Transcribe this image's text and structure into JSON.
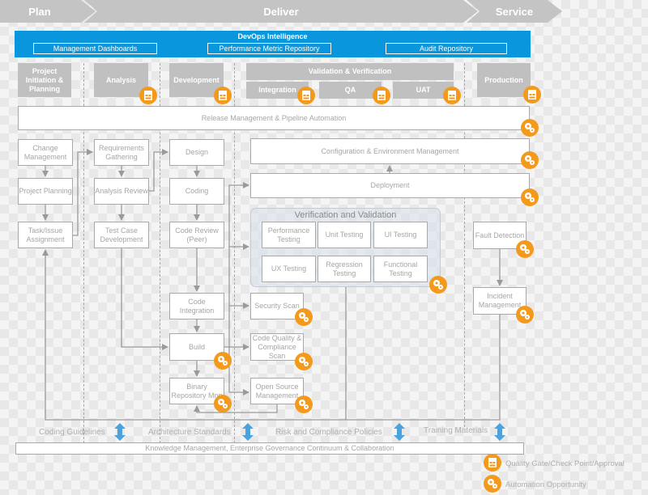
{
  "phases": [
    "Plan",
    "Deliver",
    "Service"
  ],
  "devops": {
    "title": "DevOps Intelligence",
    "boxes": [
      "Management Dashboards",
      "Performance Metric Repository",
      "Audit Repository"
    ]
  },
  "stages": {
    "project_initiation": "Project Initiation & Planning",
    "analysis": "Analysis",
    "development": "Development",
    "validation": "Validation & Verification",
    "integration": "Integration",
    "qa": "QA",
    "uat": "UAT",
    "production": "Production"
  },
  "release": "Release Management & Pipeline Automation",
  "plan_column": [
    "Change Management",
    "Project Planning",
    "Task/Issue Assignment"
  ],
  "analysis_column": [
    "Requirements Gathering",
    "Analysis Review",
    "Test Case Development"
  ],
  "dev_column": [
    "Design",
    "Coding",
    "Code Review (Peer)",
    "Code Integration",
    "Build",
    "Binary Repository Mng"
  ],
  "config_env": "Configuration & Environment Management",
  "deployment": "Deployment",
  "vv": {
    "title": "Verification and Validation",
    "tests": [
      "Performance Testing",
      "Unit Testing",
      "UI Testing",
      "UX Testing",
      "Regression Testing",
      "Functional Testing"
    ]
  },
  "scans": [
    "Security Scan",
    "Code Quality & Compliance Scan",
    "Open Source Management"
  ],
  "service_column": [
    "Fault Detection",
    "Incident Management"
  ],
  "governance": {
    "items": [
      "Coding Guidelines",
      "Architecture Standards",
      "Risk and Compliance Policies",
      "Training Materials"
    ],
    "bar": "Knowledge Management, Enterprise Governance Continuum & Collaboration"
  },
  "legend": [
    {
      "icon": "quality-gate-icon",
      "label": "Quality Gate/Check Point/Approval"
    },
    {
      "icon": "automation-gears-icon",
      "label": "Automation Opportunity"
    }
  ],
  "colors": {
    "accent_blue": "#0a96dc",
    "badge_orange": "#f39a1d",
    "stage_gray": "#c0c0c0",
    "arrow_blue": "#4aa3df"
  }
}
